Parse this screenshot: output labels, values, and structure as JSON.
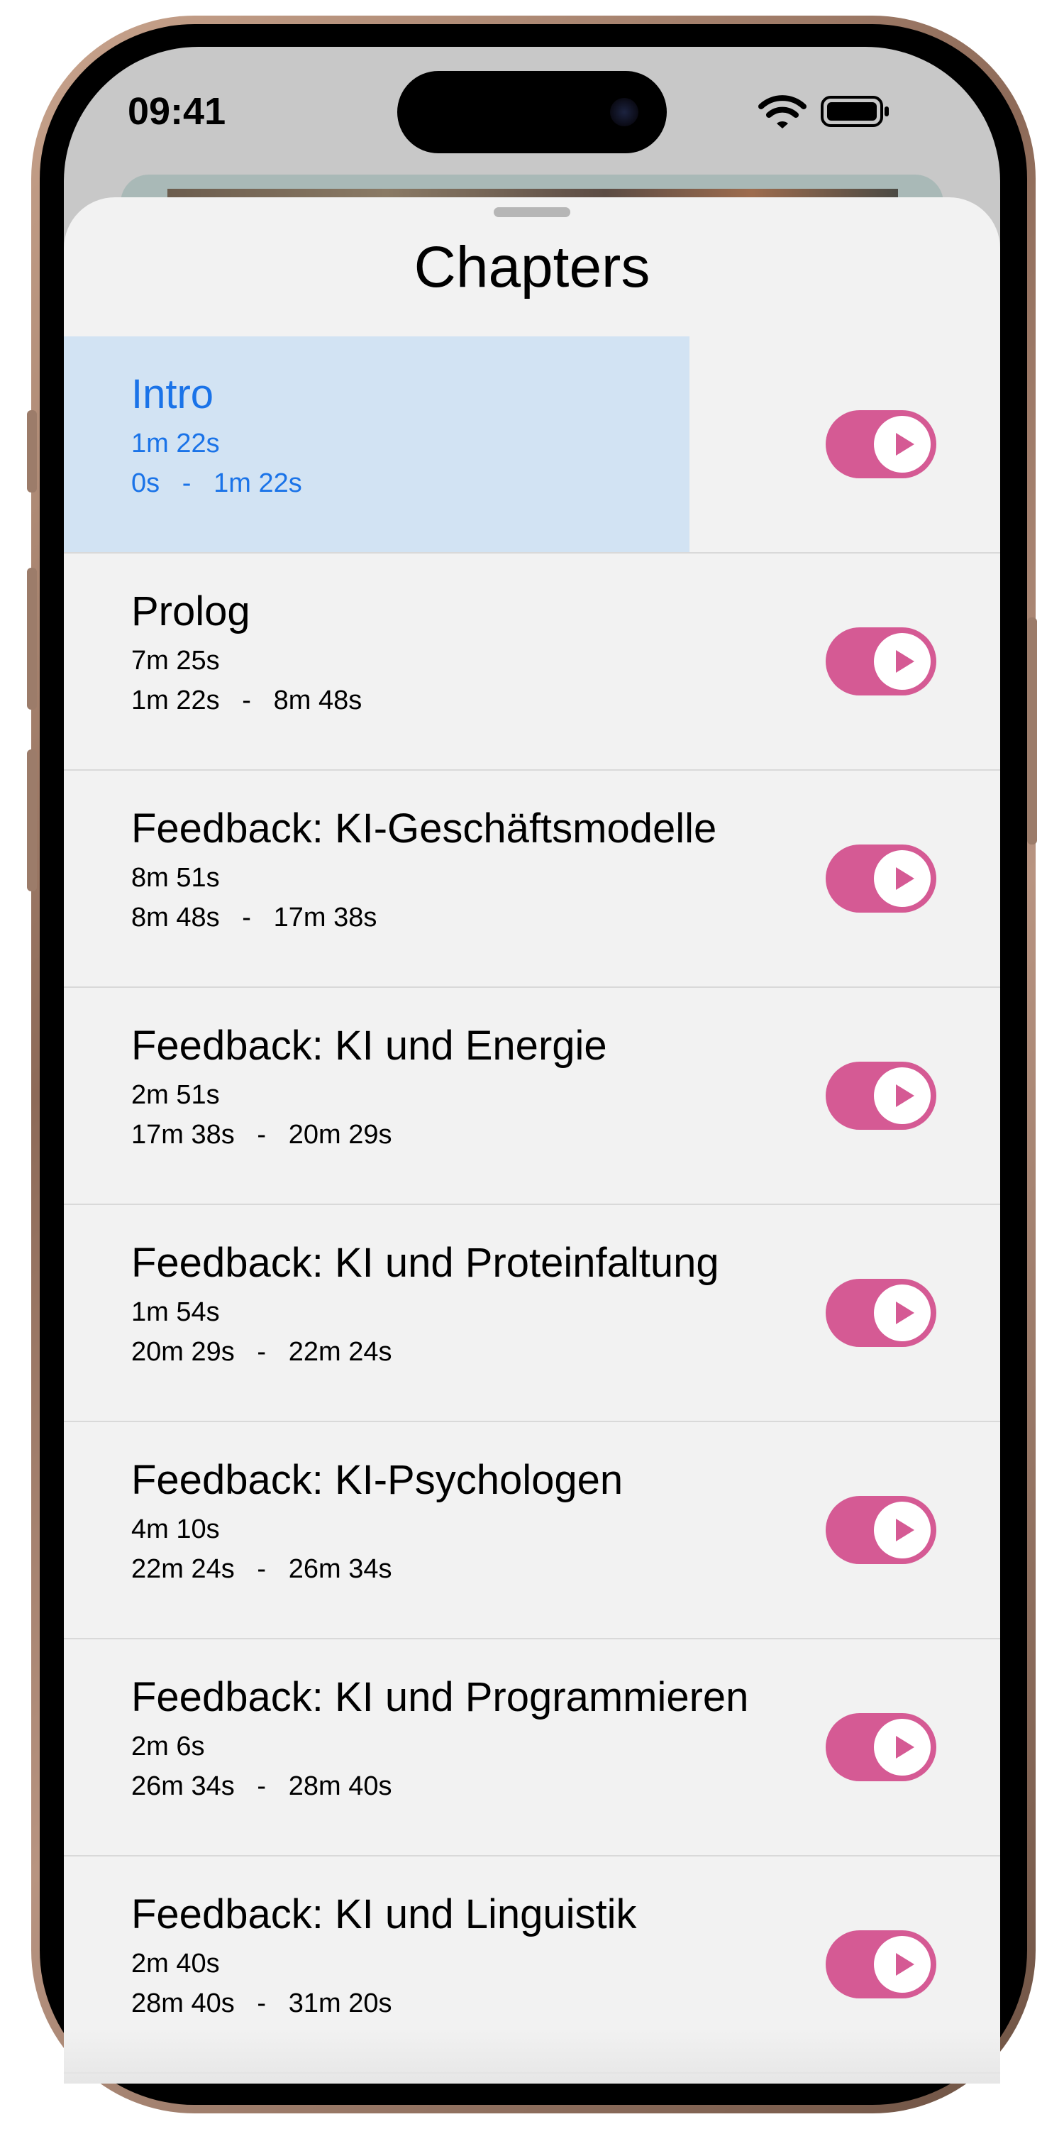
{
  "status_bar": {
    "time": "09:41"
  },
  "sheet": {
    "title": "Chapters"
  },
  "chapters": [
    {
      "title": "Intro",
      "duration": "1m 22s",
      "range": "0s   -   1m 22s",
      "active": true
    },
    {
      "title": "Prolog",
      "duration": "7m 25s",
      "range": "1m 22s   -   8m 48s"
    },
    {
      "title": "Feedback: KI-Geschäftsmodelle",
      "duration": "8m 51s",
      "range": "8m 48s   -   17m 38s"
    },
    {
      "title": "Feedback: KI und Energie",
      "duration": "2m 51s",
      "range": "17m 38s   -   20m 29s"
    },
    {
      "title": "Feedback: KI und Proteinfaltung",
      "duration": "1m 54s",
      "range": "20m 29s   -   22m 24s"
    },
    {
      "title": "Feedback: KI-Psychologen",
      "duration": "4m 10s",
      "range": "22m 24s   -   26m 34s"
    },
    {
      "title": "Feedback: KI und Programmieren",
      "duration": "2m 6s",
      "range": "26m 34s   -   28m 40s"
    },
    {
      "title": "Feedback: KI und Linguistik",
      "duration": "2m 40s",
      "range": "28m 40s   -   31m 20s"
    }
  ],
  "colors": {
    "accent": "#1a73e8",
    "active_row": "#d2e3f3",
    "play_toggle": "#d55a94",
    "sheet_background": "#f2f2f2"
  },
  "icons": {
    "status": [
      "wifi-icon",
      "battery-icon"
    ],
    "row_action": "play-icon"
  }
}
